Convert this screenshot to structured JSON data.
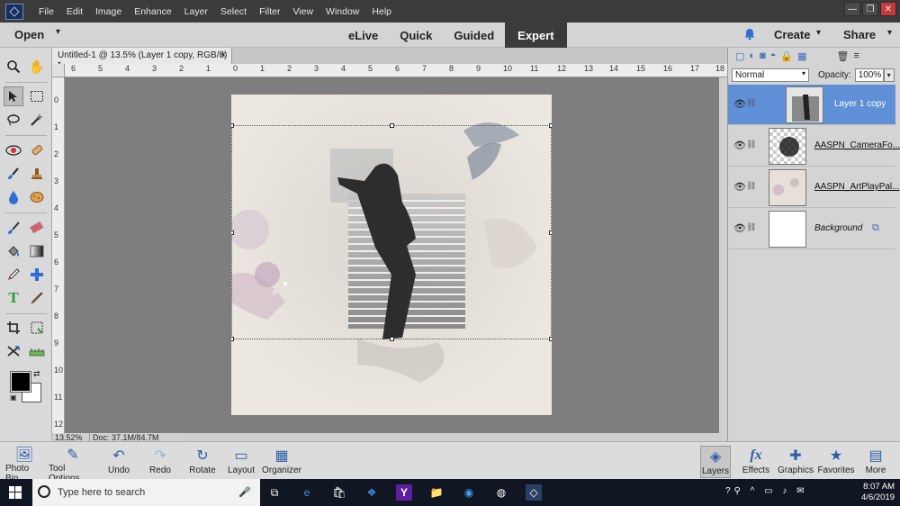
{
  "menu": [
    "File",
    "Edit",
    "Image",
    "Enhance",
    "Layer",
    "Select",
    "Filter",
    "View",
    "Window",
    "Help"
  ],
  "modebar": {
    "open": "Open",
    "modes": [
      "eLive",
      "Quick",
      "Guided",
      "Expert"
    ],
    "active_mode": "Expert",
    "create": "Create",
    "share": "Share"
  },
  "document_tab": {
    "title": "Untitled-1 @ 13.5% (Layer 1 copy, RGB/8) *",
    "close": "×"
  },
  "ruler": {
    "horizontal": [
      "6",
      "5",
      "4",
      "3",
      "2",
      "1",
      "0",
      "1",
      "2",
      "3",
      "4",
      "5",
      "6",
      "7",
      "8",
      "9",
      "10",
      "11",
      "12",
      "13",
      "14",
      "15",
      "16",
      "17",
      "18"
    ],
    "vertical": [
      "0",
      "1",
      "2",
      "3",
      "4",
      "5",
      "6",
      "7",
      "8",
      "9",
      "10",
      "11",
      "12"
    ]
  },
  "status": {
    "zoom": "13.52%",
    "doc": "Doc: 37.1M/84.7M"
  },
  "layers_panel": {
    "blend_mode": "Normal",
    "opacity_label": "Opacity:",
    "opacity_value": "100%",
    "layers": [
      {
        "name": "Layer 1 copy",
        "active": true
      },
      {
        "name": "AASPN_CameraFo...",
        "active": false
      },
      {
        "name": "AASPN_ArtPlayPal...",
        "active": false
      },
      {
        "name": "Background",
        "active": false
      }
    ]
  },
  "bottom_left": [
    "Photo Bin",
    "Tool Options",
    "Undo",
    "Redo",
    "Rotate",
    "Layout",
    "Organizer"
  ],
  "bottom_right": [
    "Layers",
    "Effects",
    "Graphics",
    "Favorites",
    "More"
  ],
  "taskbar": {
    "search_placeholder": "Type here to search",
    "time": "8:07 AM",
    "date": "4/6/2019"
  },
  "colors": {
    "accent": "#5f8fd6",
    "menubar": "#3b3b3b",
    "canvas_bg": "#7e7e7e"
  }
}
